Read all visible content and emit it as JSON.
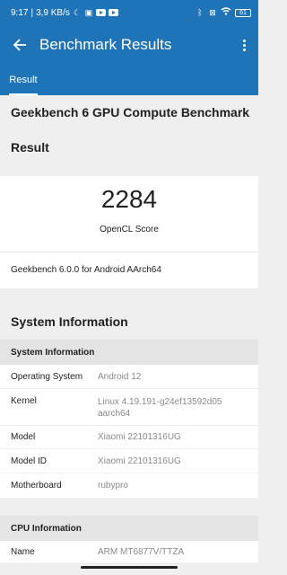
{
  "status_bar": {
    "time": "9:17",
    "separator": "|",
    "network_speed": "3,9 KB/s",
    "battery_level": "61",
    "icons": [
      "moon-icon",
      "nfc-icon",
      "youtube-icon",
      "youtube-icon",
      "bluetooth-icon",
      "no-sim-icon",
      "wifi-icon",
      "battery-icon"
    ]
  },
  "app_bar": {
    "title": "Benchmark Results",
    "back_icon": "arrow-back-icon",
    "menu_icon": "more-vert-icon"
  },
  "tabs": [
    {
      "label": "Result",
      "selected": true
    }
  ],
  "benchmark": {
    "title": "Geekbench 6 GPU Compute Benchmark",
    "result_heading": "Result",
    "score": "2284",
    "score_label": "OpenCL Score",
    "version": "Geekbench 6.0.0 for Android AArch64"
  },
  "system_information": {
    "heading": "System Information",
    "section_label": "System Information",
    "rows": [
      {
        "key": "Operating System",
        "value": "Android 12"
      },
      {
        "key": "Kernel",
        "value": "Linux 4.19.191-g24ef13592d05",
        "value_line2": "aarch64"
      },
      {
        "key": "Model",
        "value": "Xiaomi 22101316UG"
      },
      {
        "key": "Model ID",
        "value": "Xiaomi 22101316UG"
      },
      {
        "key": "Motherboard",
        "value": "rubypro"
      }
    ]
  },
  "cpu_information": {
    "section_label": "CPU Information",
    "rows": [
      {
        "key": "Name",
        "value": "ARM MT6877V/TTZA"
      }
    ]
  },
  "colors": {
    "app_bar": "#1f74b8",
    "background": "#efefef",
    "card": "#ffffff",
    "section_header": "#e4e4e4",
    "value_text": "#8a8a8a"
  }
}
